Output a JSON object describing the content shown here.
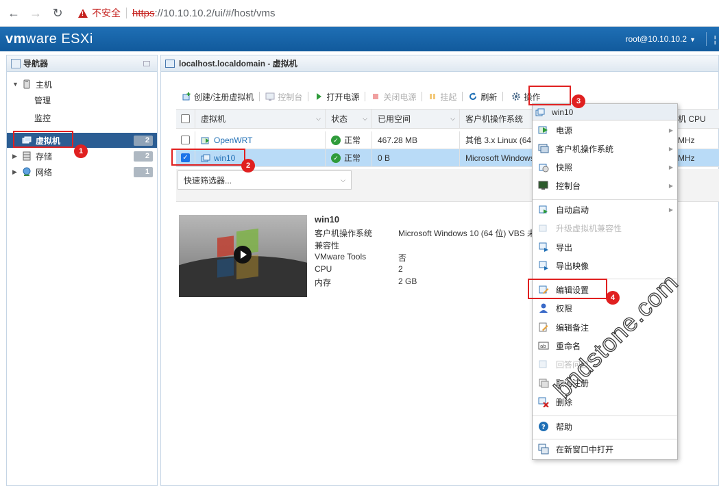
{
  "browser": {
    "security_label": "不安全",
    "url_protocol": "https",
    "url_rest": "://10.10.10.2/ui/#/host/vms"
  },
  "header": {
    "logo_vm": "vm",
    "logo_ware": "ware",
    "logo_product": "ESXi",
    "user": "root@10.10.10.2"
  },
  "navigator": {
    "title": "导航器",
    "host": {
      "label": "主机",
      "children": [
        "管理",
        "监控"
      ]
    },
    "items": [
      {
        "label": "虚拟机",
        "count": "2"
      },
      {
        "label": "存储",
        "count": "2"
      },
      {
        "label": "网络",
        "count": "1"
      }
    ]
  },
  "content": {
    "title": "localhost.localdomain - 虚拟机",
    "toolbar": {
      "create": "创建/注册虚拟机",
      "console": "控制台",
      "power_on": "打开电源",
      "power_off": "关闭电源",
      "suspend": "挂起",
      "refresh": "刷新",
      "actions": "操作"
    },
    "table": {
      "headers": [
        "虚拟机",
        "状态",
        "已用空间",
        "客户机操作系统",
        "机 CPU"
      ],
      "rows": [
        {
          "name": "OpenWRT",
          "status": "正常",
          "used": "467.28 MB",
          "os": "其他 3.x Linux (64",
          "cpu": "MHz",
          "selected": false
        },
        {
          "name": "win10",
          "status": "正常",
          "used": "0 B",
          "os": "Microsoft Windows",
          "cpu": "MHz",
          "selected": true
        }
      ]
    },
    "filter_placeholder": "快速筛选器..."
  },
  "details": {
    "name": "win10",
    "rows": [
      {
        "k": "客户机操作系统",
        "v": "Microsoft Windows 10 (64 位) VBS 未"
      },
      {
        "k": "兼容性",
        "v": ""
      },
      {
        "k": "VMware Tools",
        "v": "否"
      },
      {
        "k": "CPU",
        "v": "2"
      },
      {
        "k": "内存",
        "v": "2 GB"
      }
    ]
  },
  "actions_menu": {
    "header": "win10",
    "groups": [
      [
        {
          "label": "电源",
          "icon": "power-icon",
          "submenu": true,
          "disabled": false
        },
        {
          "label": "客户机操作系统",
          "icon": "guest-os-icon",
          "submenu": true,
          "disabled": false
        },
        {
          "label": "快照",
          "icon": "snapshot-icon",
          "submenu": true,
          "disabled": false
        },
        {
          "label": "控制台",
          "icon": "console-icon",
          "submenu": true,
          "disabled": false
        }
      ],
      [
        {
          "label": "自动启动",
          "icon": "autostart-icon",
          "submenu": true,
          "disabled": false
        },
        {
          "label": "升级虚拟机兼容性",
          "icon": "upgrade-icon",
          "submenu": false,
          "disabled": true
        },
        {
          "label": "导出",
          "icon": "export-icon",
          "submenu": false,
          "disabled": false
        },
        {
          "label": "导出映像",
          "icon": "export-image-icon",
          "submenu": false,
          "disabled": false
        }
      ],
      [
        {
          "label": "编辑设置",
          "icon": "edit-settings-icon",
          "submenu": false,
          "disabled": false
        },
        {
          "label": "权限",
          "icon": "permissions-icon",
          "submenu": false,
          "disabled": false
        },
        {
          "label": "编辑备注",
          "icon": "edit-notes-icon",
          "submenu": false,
          "disabled": false
        },
        {
          "label": "重命名",
          "icon": "rename-icon",
          "submenu": false,
          "disabled": false
        },
        {
          "label": "回答问题",
          "icon": "answer-icon",
          "submenu": false,
          "disabled": true
        },
        {
          "label": "取消注册",
          "icon": "unregister-icon",
          "submenu": false,
          "disabled": false
        },
        {
          "label": "删除",
          "icon": "delete-icon",
          "submenu": false,
          "disabled": false
        }
      ],
      [
        {
          "label": "帮助",
          "icon": "help-icon",
          "submenu": false,
          "disabled": false
        }
      ],
      [
        {
          "label": "在新窗口中打开",
          "icon": "new-window-icon",
          "submenu": false,
          "disabled": false
        }
      ]
    ]
  },
  "annotations": [
    "1",
    "2",
    "3",
    "4"
  ],
  "watermark": "bndstone.com"
}
